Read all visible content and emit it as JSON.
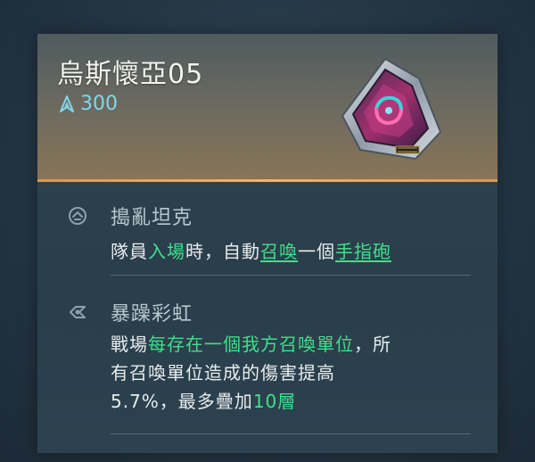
{
  "item": {
    "name": "烏斯懷亞05",
    "cost": "300",
    "cost_icon": "crystal-cost-icon",
    "gem_icon": "prism-gem-icon"
  },
  "traits": [
    {
      "name": "搗亂坦克",
      "icon": "tank-trait-icon",
      "desc": {
        "p1": "隊員",
        "h1": "入場",
        "p2": "時，自動",
        "u1": "召喚",
        "p3": "一個",
        "u2": "手指砲"
      }
    },
    {
      "name": "暴躁彩虹",
      "icon": "rainbow-trait-icon",
      "desc": {
        "line1_p": "戰場",
        "line1_h": "每存在一個我方召喚單位",
        "line1_s": "，所",
        "line2": "有召喚單位造成的傷害提高",
        "line3_p": "5.7%，最多疊加",
        "line3_h": "10層"
      }
    }
  ],
  "colors": {
    "highlight": "#3fe08a",
    "cost": "#7fd6ee",
    "header_accent": "#f0b468"
  }
}
